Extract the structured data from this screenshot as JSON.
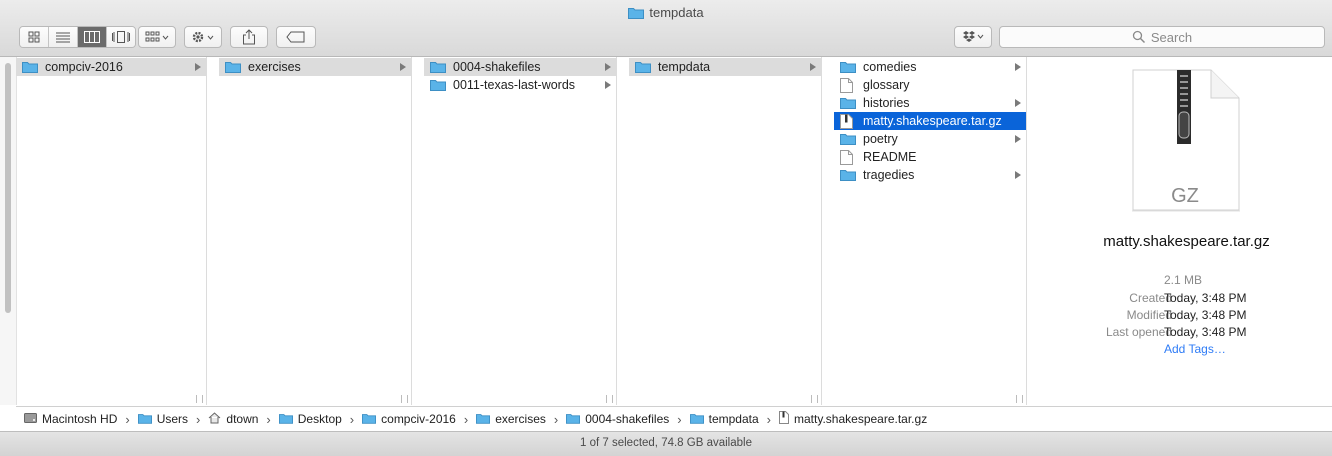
{
  "window": {
    "title": "tempdata"
  },
  "toolbar": {
    "view_modes": [
      "icon-view",
      "list-view",
      "column-view",
      "cover-flow-view"
    ],
    "active_view": "column-view",
    "search_placeholder": "Search"
  },
  "columns": [
    {
      "items": [
        {
          "label": "compciv-2016",
          "kind": "folder",
          "state": "parent",
          "has_children": true
        }
      ]
    },
    {
      "items": [
        {
          "label": "exercises",
          "kind": "folder",
          "state": "parent",
          "has_children": true
        }
      ]
    },
    {
      "items": [
        {
          "label": "0004-shakefiles",
          "kind": "folder",
          "state": "parent",
          "has_children": true
        },
        {
          "label": "0011-texas-last-words",
          "kind": "folder",
          "state": "normal",
          "has_children": true
        }
      ]
    },
    {
      "items": [
        {
          "label": "tempdata",
          "kind": "folder",
          "state": "parent",
          "has_children": true
        }
      ]
    },
    {
      "items": [
        {
          "label": "comedies",
          "kind": "folder",
          "state": "normal",
          "has_children": true
        },
        {
          "label": "glossary",
          "kind": "file",
          "state": "normal",
          "has_children": false
        },
        {
          "label": "histories",
          "kind": "folder",
          "state": "normal",
          "has_children": true
        },
        {
          "label": "matty.shakespeare.tar.gz",
          "kind": "archive",
          "state": "selected",
          "has_children": false
        },
        {
          "label": "poetry",
          "kind": "folder",
          "state": "normal",
          "has_children": true
        },
        {
          "label": "README",
          "kind": "file",
          "state": "normal",
          "has_children": false
        },
        {
          "label": "tragedies",
          "kind": "folder",
          "state": "normal",
          "has_children": true
        }
      ]
    }
  ],
  "preview": {
    "badge": "GZ",
    "name": "matty.shakespeare.tar.gz",
    "size": "2.1 MB",
    "created_label": "Created",
    "created": "Today, 3:48 PM",
    "modified_label": "Modified",
    "modified": "Today, 3:48 PM",
    "opened_label": "Last opened",
    "opened": "Today, 3:48 PM",
    "add_tags": "Add Tags…"
  },
  "path": [
    {
      "label": "Macintosh HD",
      "icon": "hard-drive-icon"
    },
    {
      "label": "Users",
      "icon": "folder-icon"
    },
    {
      "label": "dtown",
      "icon": "home-icon"
    },
    {
      "label": "Desktop",
      "icon": "folder-icon"
    },
    {
      "label": "compciv-2016",
      "icon": "folder-icon"
    },
    {
      "label": "exercises",
      "icon": "folder-icon"
    },
    {
      "label": "0004-shakefiles",
      "icon": "folder-icon"
    },
    {
      "label": "tempdata",
      "icon": "folder-icon"
    },
    {
      "label": "matty.shakespeare.tar.gz",
      "icon": "file-icon"
    }
  ],
  "status": {
    "text": "1 of 7 selected, 74.8 GB available"
  },
  "colors": {
    "accent": "#0a64d9",
    "folder": "#5ab3e8"
  }
}
